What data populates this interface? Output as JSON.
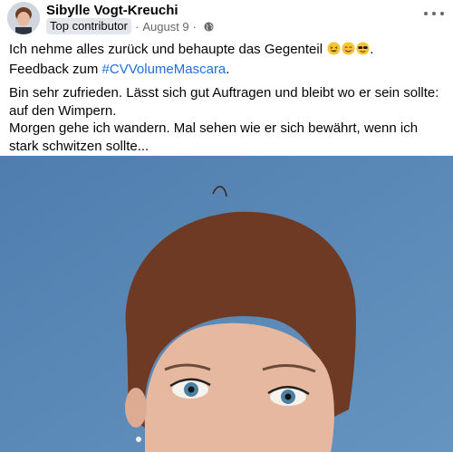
{
  "post": {
    "author": "Sibylle Vogt-Kreuchi",
    "badge": "Top contributor",
    "date": "August 9",
    "separator": "·",
    "privacy_icon": "globe-icon",
    "more_icon": "more-dots-icon",
    "line1": "Ich nehme alles zurück und behaupte das Gegenteil ",
    "line1_emojis": [
      "laughing-emoji",
      "smiling-emoji",
      "sunglasses-emoji"
    ],
    "line1_end": ".",
    "feedback_prefix": "Feedback zum ",
    "hashtag": "#CVVolumeMascara",
    "feedback_suffix": ".",
    "body_line1": "Bin sehr zufrieden. Lässt sich gut Auftragen und bleibt wo er sein sollte: auf den Wimpern.",
    "body_line2": "Morgen gehe ich wandern. Mal sehen wie er sich bewährt, wenn ich stark schwitzen sollte..."
  },
  "colors": {
    "hashtag": "#216fdb",
    "meta": "#65676b",
    "photo_background": "#5b87b3"
  }
}
